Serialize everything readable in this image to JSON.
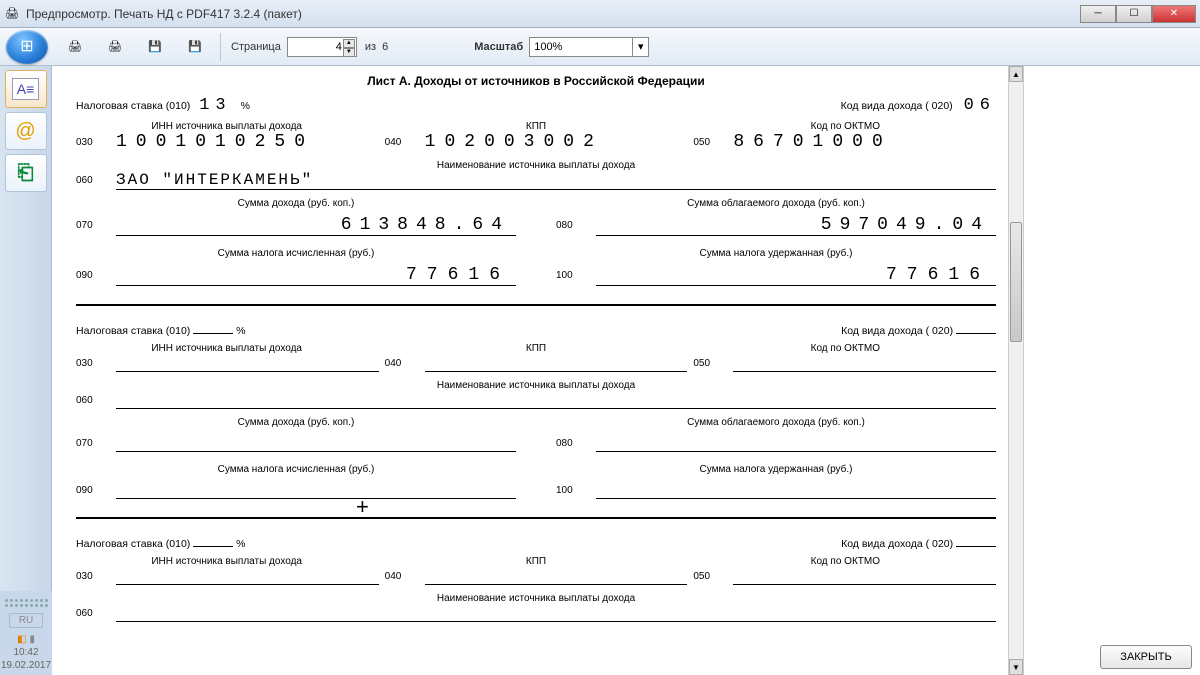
{
  "window": {
    "title": "Предпросмотр. Печать НД с PDF417 3.2.4 (пакет)"
  },
  "toolbar": {
    "page_label": "Страница",
    "page_value": "4",
    "of_label": "из",
    "total_pages": "6",
    "zoom_label": "Масштаб",
    "zoom_value": "100%"
  },
  "tray": {
    "lang": "RU",
    "time": "10:42",
    "date": "19.02.2017"
  },
  "close_label": "ЗАКРЫТЬ",
  "doc": {
    "title": "Лист А. Доходы от источников в Российской Федерации",
    "labels": {
      "tax_rate": "Налоговая ставка (010)",
      "percent": "%",
      "income_code": "Код вида дохода ( 020)",
      "inn_src": "ИНН источника выплаты дохода",
      "kpp": "КПП",
      "oktmo": "Код по ОКТМО",
      "src_name": "Наименование источника выплаты дохода",
      "income_sum": "Сумма дохода (руб. коп.)",
      "taxable_sum": "Сумма облагаемого дохода (руб. коп.)",
      "tax_calc": "Сумма налога исчисленная (руб.)",
      "tax_withheld": "Сумма налога удержанная (руб.)"
    },
    "codes": {
      "c030": "030",
      "c040": "040",
      "c050": "050",
      "c060": "060",
      "c070": "070",
      "c080": "080",
      "c090": "090",
      "c100": "100"
    },
    "block1": {
      "tax_rate": "13",
      "income_code": "06",
      "inn": "1001010250",
      "kpp": "102003002",
      "oktmo": "86701000",
      "name": "ЗАО \"ИНТЕРКАМЕНЬ\"",
      "income_sum": "613848.64",
      "taxable_sum": "597049.04",
      "tax_calc": "77616",
      "tax_withheld": "77616"
    }
  }
}
